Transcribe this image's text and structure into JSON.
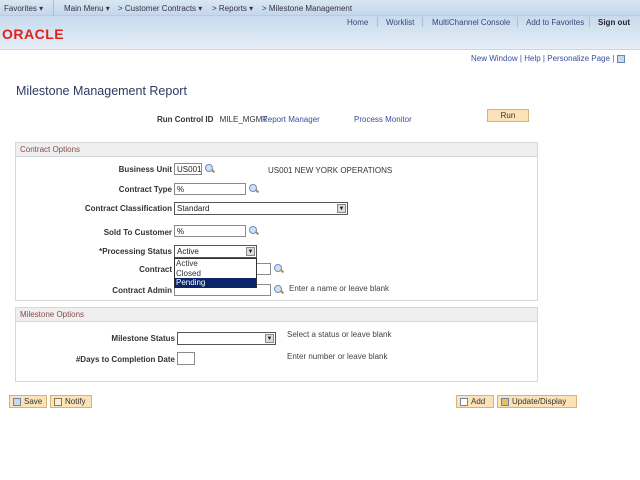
{
  "topnav": {
    "favorites": "Favorites",
    "main_menu": "Main Menu",
    "customer_contracts": "Customer Contracts",
    "reports": "Reports",
    "milestone_management": "Milestone Management"
  },
  "header": {
    "logo": "ORACLE",
    "links": [
      "Home",
      "Worklist",
      "MultiChannel Console",
      "Add to Favorites",
      "Sign out"
    ]
  },
  "pagebar": {
    "new_window": "New Window",
    "help": "Help",
    "personalize": "Personalize Page"
  },
  "page_title": "Milestone Management Report",
  "run_control": {
    "label": "Run Control ID",
    "value": "MILE_MGMT",
    "report_manager": "Report Manager",
    "process_monitor": "Process Monitor",
    "run": "Run"
  },
  "contract_options": {
    "title": "Contract Options",
    "business_unit": {
      "label": "Business Unit",
      "value": "US001",
      "description": "US001 NEW YORK OPERATIONS"
    },
    "contract_type": {
      "label": "Contract Type",
      "value": "%"
    },
    "classification": {
      "label": "Contract Classification",
      "value": "Standard"
    },
    "sold_to": {
      "label": "Sold To Customer",
      "value": "%"
    },
    "processing_status": {
      "label": "*Processing Status",
      "value": "Active",
      "options": [
        "Active",
        "Closed",
        "Pending"
      ],
      "highlighted": "Pending"
    },
    "contract": {
      "label": "Contract",
      "value": ""
    },
    "contract_admin": {
      "label": "Contract Admin",
      "value": "",
      "hint": "Enter a name or leave blank"
    }
  },
  "milestone_options": {
    "title": "Milestone Options",
    "status": {
      "label": "Milestone Status",
      "value": "",
      "hint": "Select a status or leave blank"
    },
    "days": {
      "label": "#Days to Completion Date",
      "value": "",
      "hint": "Enter number or leave blank"
    }
  },
  "buttons": {
    "save": "Save",
    "notify": "Notify",
    "add": "Add",
    "update": "Update/Display"
  }
}
